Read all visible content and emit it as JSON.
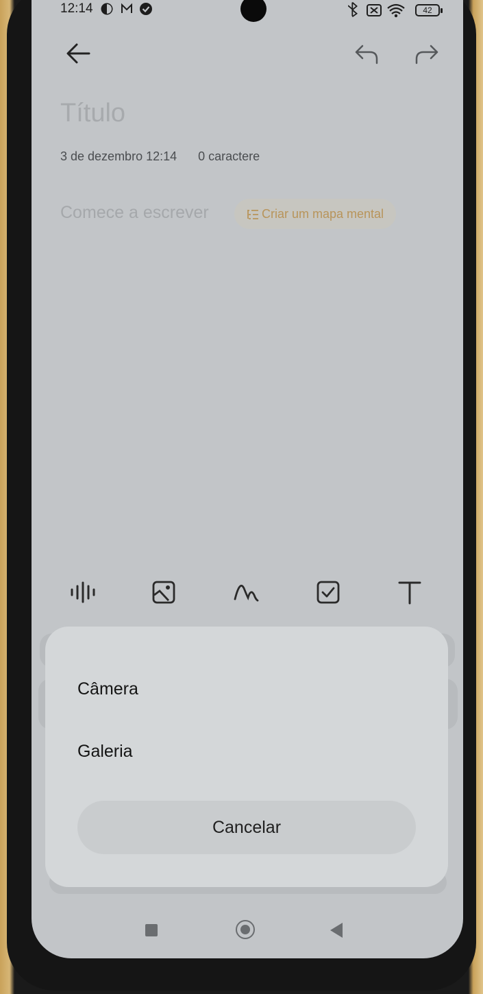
{
  "status_bar": {
    "time": "12:14",
    "battery": "42",
    "left_icons": [
      "theme-icon",
      "gmail-icon",
      "check-circle-icon"
    ],
    "right_icons": [
      "bluetooth-icon",
      "sim-off-icon",
      "wifi-icon",
      "battery-icon"
    ]
  },
  "header": {
    "back_icon": "arrow-left-icon",
    "undo_icon": "undo-icon",
    "redo_icon": "redo-icon"
  },
  "note": {
    "title_placeholder": "Título",
    "date": "3 de dezembro  12:14",
    "char_count": "0 caractere",
    "body_placeholder": "Comece a escrever",
    "mindmap_button": "Criar um mapa mental"
  },
  "toolbar": {
    "items": [
      "audio-wave-icon",
      "image-icon",
      "handwriting-icon",
      "checkbox-icon",
      "text-format-icon"
    ]
  },
  "sheet": {
    "options": [
      "Câmera",
      "Galeria"
    ],
    "cancel_label": "Cancelar"
  },
  "navbar": {
    "items": [
      "recents-square-icon",
      "home-circle-icon",
      "back-triangle-icon"
    ]
  },
  "colors": {
    "screen_background": "#c2c5c8",
    "sheet_background": "#d4d7d9",
    "accent_mindmap": "#b8945a"
  }
}
